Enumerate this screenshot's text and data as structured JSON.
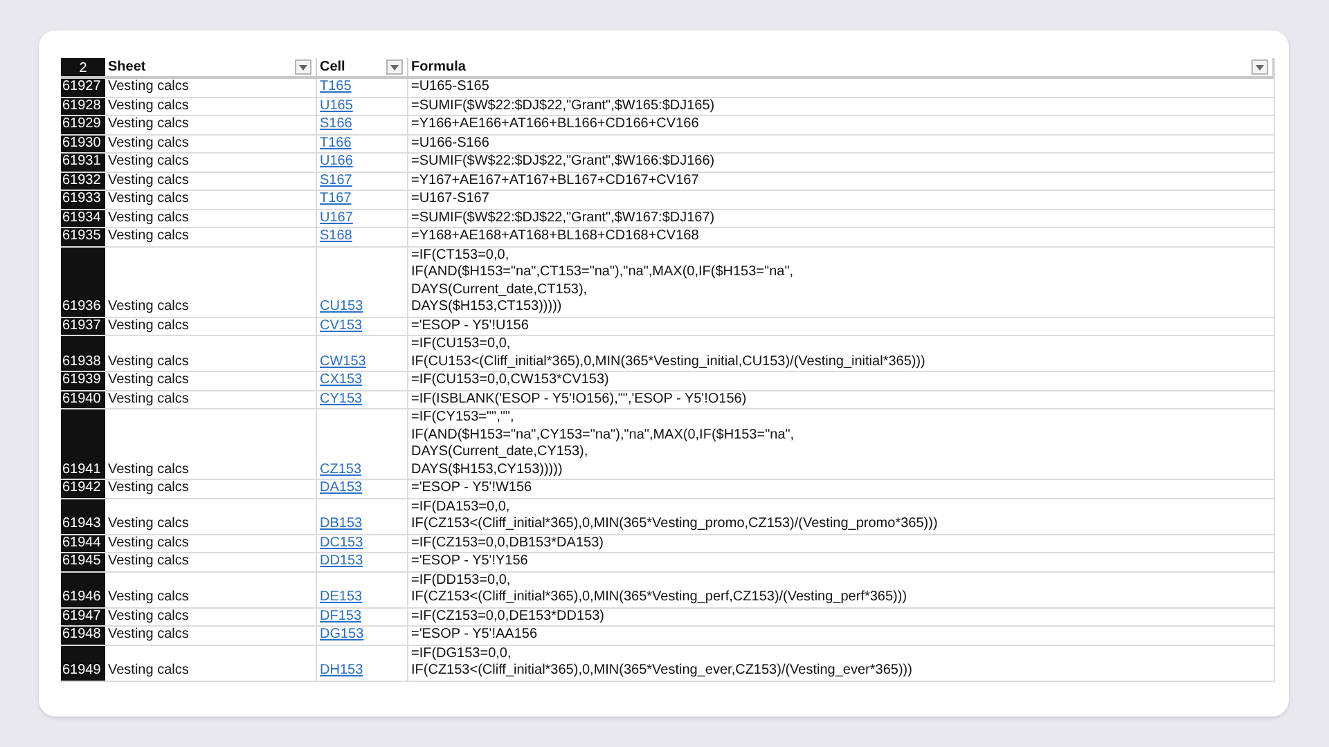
{
  "header": {
    "row_number": "2",
    "columns": [
      {
        "label": "Sheet"
      },
      {
        "label": "Cell"
      },
      {
        "label": "Formula"
      }
    ]
  },
  "rows": [
    {
      "number": "61927",
      "sheet": "Vesting calcs",
      "cell": "T165",
      "formula": [
        "=U165-S165"
      ]
    },
    {
      "number": "61928",
      "sheet": "Vesting calcs",
      "cell": "U165",
      "formula": [
        "=SUMIF($W$22:$DJ$22,\"Grant\",$W165:$DJ165)"
      ]
    },
    {
      "number": "61929",
      "sheet": "Vesting calcs",
      "cell": "S166",
      "formula": [
        "=Y166+AE166+AT166+BL166+CD166+CV166"
      ]
    },
    {
      "number": "61930",
      "sheet": "Vesting calcs",
      "cell": "T166",
      "formula": [
        "=U166-S166"
      ]
    },
    {
      "number": "61931",
      "sheet": "Vesting calcs",
      "cell": "U166",
      "formula": [
        "=SUMIF($W$22:$DJ$22,\"Grant\",$W166:$DJ166)"
      ]
    },
    {
      "number": "61932",
      "sheet": "Vesting calcs",
      "cell": "S167",
      "formula": [
        "=Y167+AE167+AT167+BL167+CD167+CV167"
      ]
    },
    {
      "number": "61933",
      "sheet": "Vesting calcs",
      "cell": "T167",
      "formula": [
        "=U167-S167"
      ]
    },
    {
      "number": "61934",
      "sheet": "Vesting calcs",
      "cell": "U167",
      "formula": [
        "=SUMIF($W$22:$DJ$22,\"Grant\",$W167:$DJ167)"
      ]
    },
    {
      "number": "61935",
      "sheet": "Vesting calcs",
      "cell": "S168",
      "formula": [
        "=Y168+AE168+AT168+BL168+CD168+CV168"
      ]
    },
    {
      "number": "61936",
      "sheet": "Vesting calcs",
      "cell": "CU153",
      "formula": [
        "=IF(CT153=0,0,",
        "IF(AND($H153=\"na\",CT153=\"na\"),\"na\",MAX(0,IF($H153=\"na\",",
        "DAYS(Current_date,CT153),",
        "DAYS($H153,CT153)))))"
      ]
    },
    {
      "number": "61937",
      "sheet": "Vesting calcs",
      "cell": "CV153",
      "formula": [
        "='ESOP - Y5'!U156"
      ]
    },
    {
      "number": "61938",
      "sheet": "Vesting calcs",
      "cell": "CW153",
      "formula": [
        "=IF(CU153=0,0,",
        "IF(CU153<(Cliff_initial*365),0,MIN(365*Vesting_initial,CU153)/(Vesting_initial*365)))"
      ]
    },
    {
      "number": "61939",
      "sheet": "Vesting calcs",
      "cell": "CX153",
      "formula": [
        "=IF(CU153=0,0,CW153*CV153)"
      ]
    },
    {
      "number": "61940",
      "sheet": "Vesting calcs",
      "cell": "CY153",
      "formula": [
        "=IF(ISBLANK('ESOP - Y5'!O156),\"\",'ESOP - Y5'!O156)"
      ]
    },
    {
      "number": "61941",
      "sheet": "Vesting calcs",
      "cell": "CZ153",
      "formula": [
        "=IF(CY153=\"\",\"\",",
        "IF(AND($H153=\"na\",CY153=\"na\"),\"na\",MAX(0,IF($H153=\"na\",",
        "DAYS(Current_date,CY153),",
        "DAYS($H153,CY153)))))"
      ]
    },
    {
      "number": "61942",
      "sheet": "Vesting calcs",
      "cell": "DA153",
      "formula": [
        "='ESOP - Y5'!W156"
      ]
    },
    {
      "number": "61943",
      "sheet": "Vesting calcs",
      "cell": "DB153",
      "formula": [
        "=IF(DA153=0,0,",
        "IF(CZ153<(Cliff_initial*365),0,MIN(365*Vesting_promo,CZ153)/(Vesting_promo*365)))"
      ]
    },
    {
      "number": "61944",
      "sheet": "Vesting calcs",
      "cell": "DC153",
      "formula": [
        "=IF(CZ153=0,0,DB153*DA153)"
      ]
    },
    {
      "number": "61945",
      "sheet": "Vesting calcs",
      "cell": "DD153",
      "formula": [
        "='ESOP - Y5'!Y156"
      ]
    },
    {
      "number": "61946",
      "sheet": "Vesting calcs",
      "cell": "DE153",
      "formula": [
        "=IF(DD153=0,0,",
        "IF(CZ153<(Cliff_initial*365),0,MIN(365*Vesting_perf,CZ153)/(Vesting_perf*365)))"
      ]
    },
    {
      "number": "61947",
      "sheet": "Vesting calcs",
      "cell": "DF153",
      "formula": [
        "=IF(CZ153=0,0,DE153*DD153)"
      ]
    },
    {
      "number": "61948",
      "sheet": "Vesting calcs",
      "cell": "DG153",
      "formula": [
        "='ESOP - Y5'!AA156"
      ]
    },
    {
      "number": "61949",
      "sheet": "Vesting calcs",
      "cell": "DH153",
      "formula": [
        "=IF(DG153=0,0,",
        "IF(CZ153<(Cliff_initial*365),0,MIN(365*Vesting_ever,CZ153)/(Vesting_ever*365)))"
      ]
    }
  ]
}
